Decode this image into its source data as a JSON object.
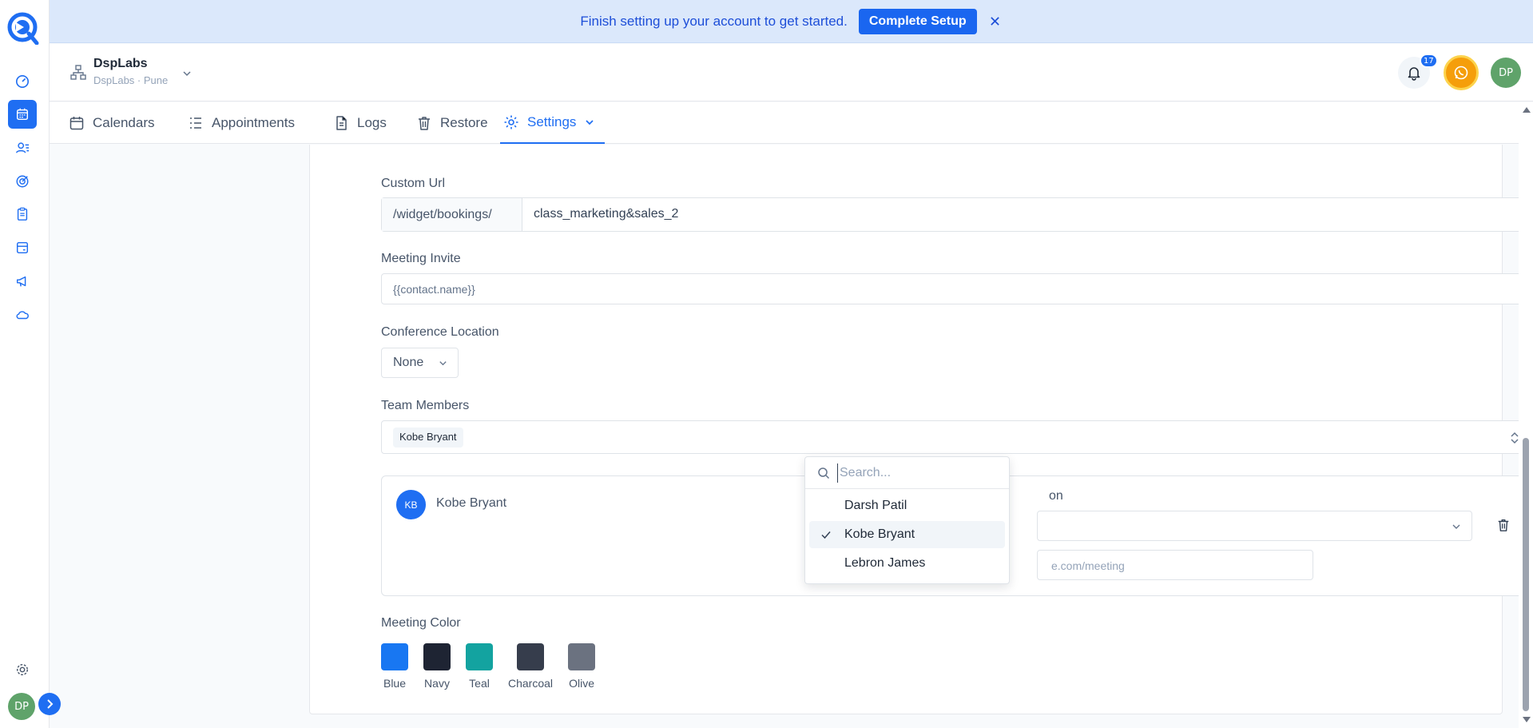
{
  "banner": {
    "message": "Finish setting up your account to get started.",
    "button_label": "Complete Setup"
  },
  "sidebar": {
    "items": [
      "dashboard",
      "calendar",
      "contacts",
      "opportunities",
      "tasks",
      "payments",
      "marketing",
      "cloud"
    ],
    "active": "calendar",
    "user_initials": "DP"
  },
  "header": {
    "org_name": "DspLabs",
    "org_location": "DspLabs · Pune",
    "notification_count": "17",
    "user_initials": "DP"
  },
  "tabs": [
    {
      "label": "Calendars",
      "icon": "calendar-icon"
    },
    {
      "label": "Appointments",
      "icon": "list-icon"
    },
    {
      "label": "Logs",
      "icon": "document-icon"
    },
    {
      "label": "Restore",
      "icon": "trash-icon"
    },
    {
      "label": "Settings",
      "icon": "gear-icon",
      "active": true
    }
  ],
  "form": {
    "custom_url": {
      "label": "Custom Url",
      "prefix": "/widget/bookings/",
      "value": "class_marketing&sales_2"
    },
    "meeting_invite": {
      "label": "Meeting Invite",
      "placeholder": "{{contact.name}}"
    },
    "conference_location": {
      "label": "Conference Location",
      "value": "None"
    },
    "team_members": {
      "label": "Team Members",
      "selected": [
        "Kobe Bryant"
      ]
    },
    "member_card": {
      "initials": "KB",
      "name": "Kobe Bryant",
      "location_label_partial": "on",
      "url_placeholder_partial": "e.com/meeting"
    },
    "meeting_color": {
      "label": "Meeting Color",
      "options": [
        {
          "name": "Blue",
          "hex": "#1877f2"
        },
        {
          "name": "Navy",
          "hex": "#1e2433"
        },
        {
          "name": "Teal",
          "hex": "#13a3a0"
        },
        {
          "name": "Charcoal",
          "hex": "#363d4c"
        },
        {
          "name": "Olive",
          "hex": "#6b7280"
        }
      ]
    }
  },
  "dropdown": {
    "search_placeholder": "Search...",
    "options": [
      {
        "name": "Darsh Patil",
        "selected": false
      },
      {
        "name": "Kobe Bryant",
        "selected": true
      },
      {
        "name": "Lebron James",
        "selected": false
      }
    ]
  },
  "colors": {
    "accent": "#1f6ef2",
    "banner_bg": "#dbe8fb"
  }
}
